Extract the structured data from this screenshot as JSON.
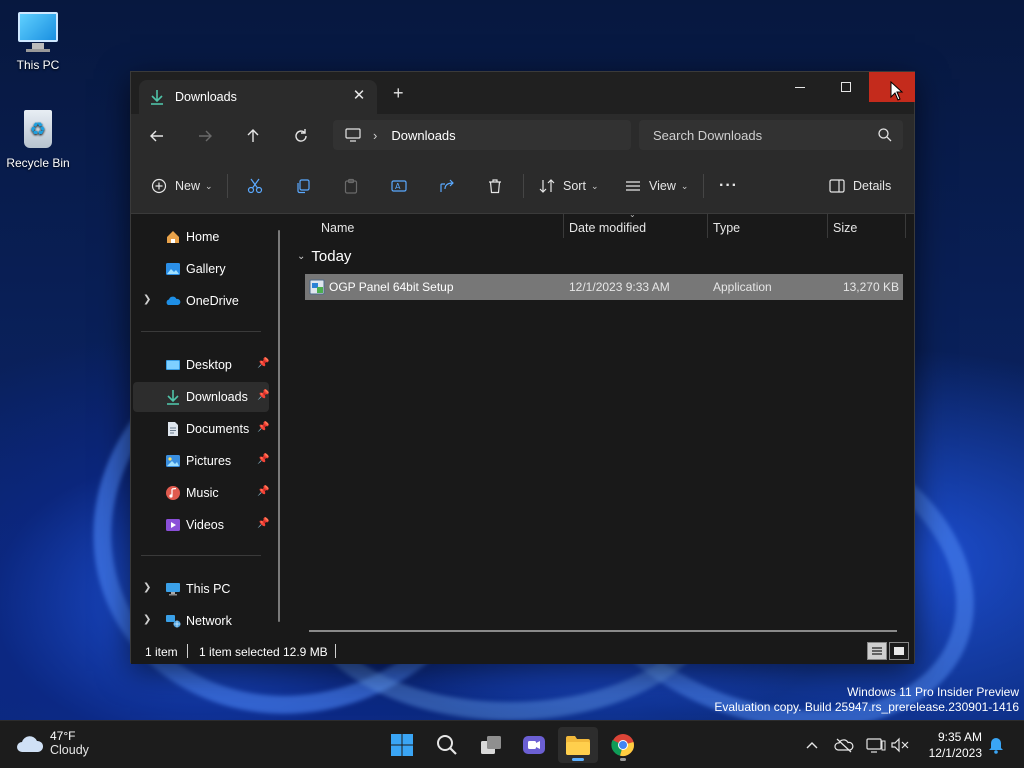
{
  "desktop": {
    "icons": [
      {
        "label": "This PC"
      },
      {
        "label": "Recycle Bin"
      }
    ],
    "watermark_line1": "Windows 11 Pro Insider Preview",
    "watermark_line2": "Evaluation copy. Build 25947.rs_prerelease.230901-1416"
  },
  "window": {
    "tab_title": "Downloads",
    "address": {
      "location": "Downloads"
    },
    "search": {
      "placeholder": "Search Downloads"
    },
    "toolbar": {
      "new_label": "New",
      "sort_label": "Sort",
      "view_label": "View",
      "details_label": "Details"
    },
    "sidebar": {
      "items": [
        {
          "label": "Home",
          "icon": "home-icon"
        },
        {
          "label": "Gallery",
          "icon": "gallery-icon"
        },
        {
          "label": "OneDrive",
          "icon": "onedrive-icon"
        },
        {
          "label": "Desktop",
          "icon": "desktop-folder-icon",
          "pinned": true
        },
        {
          "label": "Downloads",
          "icon": "downloads-folder-icon",
          "pinned": true,
          "selected": true
        },
        {
          "label": "Documents",
          "icon": "documents-folder-icon",
          "pinned": true
        },
        {
          "label": "Pictures",
          "icon": "pictures-folder-icon",
          "pinned": true
        },
        {
          "label": "Music",
          "icon": "music-folder-icon",
          "pinned": true
        },
        {
          "label": "Videos",
          "icon": "videos-folder-icon",
          "pinned": true
        },
        {
          "label": "This PC",
          "icon": "this-pc-icon"
        },
        {
          "label": "Network",
          "icon": "network-icon"
        }
      ]
    },
    "columns": {
      "name": "Name",
      "date": "Date modified",
      "type": "Type",
      "size": "Size"
    },
    "groups": [
      {
        "label": "Today",
        "files": [
          {
            "name": "OGP Panel 64bit Setup",
            "date": "12/1/2023 9:33 AM",
            "type": "Application",
            "size": "13,270 KB",
            "selected": true
          }
        ]
      }
    ],
    "status": {
      "count": "1 item",
      "selection": "1 item selected",
      "selection_size": "12.9 MB"
    }
  },
  "taskbar": {
    "weather": {
      "temp": "47°F",
      "condition": "Cloudy"
    },
    "clock": {
      "time": "9:35 AM",
      "date": "12/1/2023"
    },
    "apps": [
      "start",
      "search",
      "task-view",
      "teams",
      "file-explorer",
      "chrome"
    ]
  },
  "colors": {
    "accent": "#5cb0ff",
    "close_red": "#c42b1c",
    "window_bg": "#191919",
    "toolbar_bg": "#2b2b2b",
    "selected_row": "#777777"
  }
}
